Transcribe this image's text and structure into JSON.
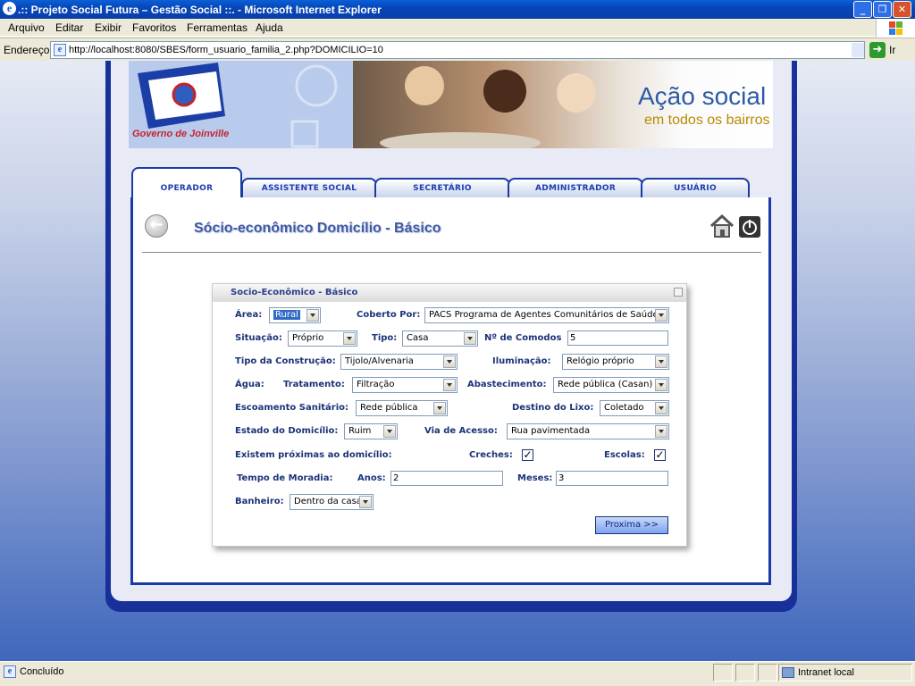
{
  "window": {
    "title": ".:: Projeto Social Futura – Gestão Social ::. - Microsoft Internet Explorer",
    "minimize_icon": "_",
    "restore_icon": "❐",
    "close_icon": "✕"
  },
  "menu": [
    "Arquivo",
    "Editar",
    "Exibir",
    "Favoritos",
    "Ferramentas",
    "Ajuda"
  ],
  "address": {
    "label": "Endereço",
    "url": "http://localhost:8080/SBES/form_usuario_familia_2.php?DOMICILIO=10",
    "go_label": "Ir"
  },
  "header": {
    "logo_text": "Governo de Joinville",
    "slogan_title": "Ação social",
    "slogan_sub": "em todos os bairros"
  },
  "tabs": [
    "Operador",
    "Assistente Social",
    "Secretário",
    "Administrador",
    "Usuário"
  ],
  "page_title": "Sócio-econômico Domicílio - Básico",
  "form": {
    "title": "Socio-Econômico - Básico",
    "area_label": "Área:",
    "area_value": "Rural",
    "coberto_label": "Coberto Por:",
    "coberto_value": "PACS Programa de Agentes Comunitários de Saúde",
    "situacao_label": "Situação:",
    "situacao_value": "Próprio",
    "tipo_label": "Tipo:",
    "tipo_value": "Casa",
    "comodos_label": "Nº de Comodos",
    "comodos_value": "5",
    "construcao_label": "Tipo da Construção:",
    "construcao_value": "Tijolo/Alvenaria",
    "iluminacao_label": "Iluminação:",
    "iluminacao_value": "Relógio próprio",
    "agua_label": "Água:",
    "tratamento_label": "Tratamento:",
    "tratamento_value": "Filtração",
    "abastecimento_label": "Abastecimento:",
    "abastecimento_value": "Rede pública (Casan)",
    "escoamento_label": "Escoamento Sanitário:",
    "escoamento_value": "Rede pública",
    "lixo_label": "Destino do Lixo:",
    "lixo_value": "Coletado",
    "estado_label": "Estado do Domicílio:",
    "estado_value": "Ruim",
    "via_label": "Via de Acesso:",
    "via_value": "Rua pavimentada",
    "proximas_label": "Existem próximas ao domicílio:",
    "creches_label": "Creches:",
    "creches_checked": true,
    "escolas_label": "Escolas:",
    "escolas_checked": true,
    "moradia_label": "Tempo de Moradia:",
    "anos_label": "Anos:",
    "anos_value": "2",
    "meses_label": "Meses:",
    "meses_value": "3",
    "banheiro_label": "Banheiro:",
    "banheiro_value": "Dentro da casa",
    "next_label": "Proxima >>",
    "check_mark": "✓"
  },
  "status": {
    "text": "Concluído",
    "zone": "Intranet local"
  },
  "colors": {
    "accent": "#1a3aa6",
    "title_text": "#3f5aa3",
    "slogan": "#2d5aa8",
    "slogan_sub": "#b58a00"
  }
}
